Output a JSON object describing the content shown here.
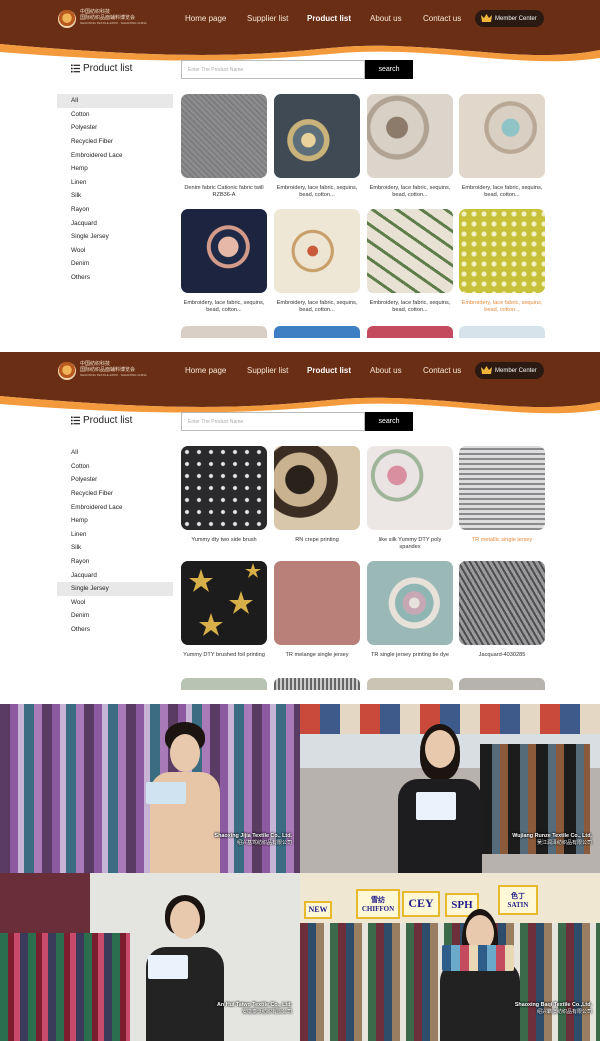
{
  "header": {
    "logo_cn": "中国纺织科技",
    "logo_cn2": "国际纺织品面辅料博览会",
    "logo_en": "SHAOXING TEXTILE EXPO · SHAOXING CHINA",
    "nav": [
      "Home page",
      "Supplier list",
      "Product list",
      "About us",
      "Contact us"
    ],
    "member": "Member Center"
  },
  "product_section": {
    "title": "Product list",
    "search_placeholder": "Enter The Product Name",
    "search_button": "search"
  },
  "categories": [
    "All",
    "Cotton",
    "Polyester",
    "Recycled Fiber",
    "Embroidered Lace",
    "Hemp",
    "Linen",
    "Silk",
    "Rayon",
    "Jacquard",
    "Single Jersey",
    "Wool",
    "Denim",
    "Others"
  ],
  "view1": {
    "active_category": "All",
    "products": [
      "Denim fabric Cationic fabric twill RZB36-A",
      "Embroidery, lace fabric, sequins, bead, cotton...",
      "Embroidery, lace fabric, sequins, bead, cotton...",
      "Embroidery, lace fabric, sequins, bead, cotton...",
      "Embroidery, lace fabric, sequins, bead, cotton...",
      "Embroidery, lace fabric, sequins, bead, cotton...",
      "Embroidery, lace fabric, sequins, bead, cotton...",
      "Embroidery, lace fabric, sequins, bead, cotton..."
    ]
  },
  "view2": {
    "active_category": "Single Jersey",
    "products": [
      "Yummy dty two side brush",
      "RN crepe printing",
      "like silk Yummy DTY poly spandex",
      "TR metallic single jersey",
      "Yummy DTY brushed foil printing",
      "TR melange single jersey",
      "TR single jersey printing tie dye",
      "Jacquard-4030285"
    ]
  },
  "videos": [
    {
      "company": "Shaoxing Jijia Textile Co., Ltd.",
      "company_cn": "绍兴基驾纺织品有限公司"
    },
    {
      "company": "Wujiang Runze Textile Co., Ltd.",
      "company_cn": "吴江润泽纺织品有限公司"
    },
    {
      "company": "An Hui Taiwo Textile Co., Ltd.",
      "company_cn": "安徽泰沃纺织有限公司"
    },
    {
      "company": "Shaoxing Baqi Textile Co.,Ltd.",
      "company_cn": "绍兴霸旗纺织品有限公司"
    }
  ],
  "booth_signs": [
    "NEW",
    "CHIFFON",
    "CEY",
    "SPH",
    "SATIN",
    "雪纺",
    "色丁"
  ],
  "colors": {
    "header_brown": "#6a2e14",
    "accent_orange": "#e58a3c",
    "wave_orange": "#f39a3d"
  }
}
